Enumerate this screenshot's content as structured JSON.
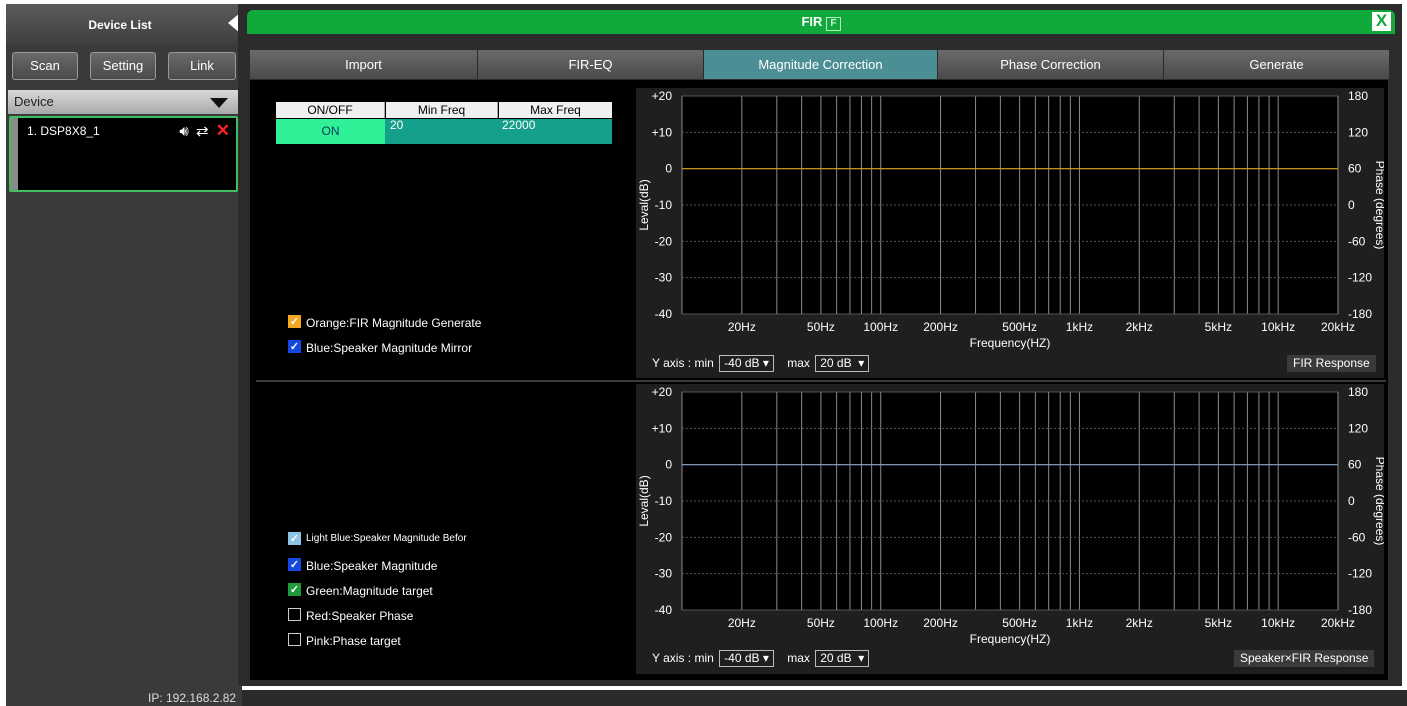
{
  "sidebar": {
    "title": "Device List",
    "buttons": {
      "scan": "Scan",
      "setting": "Setting",
      "link": "Link"
    },
    "device_header": "Device",
    "devices": [
      {
        "name": "1. DSP8X8_1"
      }
    ]
  },
  "status": {
    "ip": "IP: 192.168.2.82"
  },
  "window": {
    "title": "FIR",
    "badge": "F",
    "close": "X"
  },
  "tabs": [
    "Import",
    "FIR-EQ",
    "Magnitude Correction",
    "Phase Correction",
    "Generate"
  ],
  "active_tab": "Magnitude Correction",
  "freq_table": {
    "headers": [
      "ON/OFF",
      "Min Freq",
      "Max Freq"
    ],
    "row": {
      "onoff": "ON",
      "min": "20",
      "max": "22000"
    }
  },
  "top_legend": [
    {
      "label": "Orange:FIR Magnitude Generate",
      "checked": true,
      "color": "#f5a623"
    },
    {
      "label": "Blue:Speaker Magnitude Mirror",
      "checked": true,
      "color": "#1448e0"
    }
  ],
  "bottom_legend": [
    {
      "label": "Light Blue:Speaker Magnitude Befor",
      "checked": true,
      "color": "#8ec3e8"
    },
    {
      "label": "Blue:Speaker Magnitude",
      "checked": true,
      "color": "#1448e0"
    },
    {
      "label": "Green:Magnitude target",
      "checked": true,
      "color": "#1f9a3a"
    },
    {
      "label": "Red:Speaker Phase",
      "checked": false
    },
    {
      "label": "Pink:Phase target",
      "checked": false
    }
  ],
  "charts": {
    "y_ticks": [
      "+20",
      "+10",
      "0",
      "-10",
      "-20",
      "-30",
      "-40"
    ],
    "phase_ticks": [
      "180",
      "120",
      "60",
      "0",
      "-60",
      "-120",
      "-180"
    ],
    "x_ticks": [
      "20Hz",
      "50Hz",
      "100Hz",
      "200Hz",
      "500Hz",
      "1kHz",
      "2kHz",
      "5kHz",
      "10kHz",
      "20kHz"
    ],
    "ylabel": "Leval(dB)",
    "xlabel": "Frequency(HZ)",
    "phase_label": "Phase (degrees)",
    "yaxis": {
      "min_label": "Y axis : min",
      "min_value": "-40 dB",
      "max_label": "max",
      "max_value": "20 dB"
    },
    "top_button": "FIR Response",
    "bottom_button": "Speaker×FIR Response"
  },
  "chart_data": [
    {
      "type": "line",
      "title": "FIR Response",
      "xlabel": "Frequency(HZ)",
      "ylabel": "Leval(dB)",
      "xscale": "log",
      "xlim": [
        10,
        20000
      ],
      "ylim": [
        -40,
        20
      ],
      "y2label": "Phase (degrees)",
      "y2lim": [
        -180,
        180
      ],
      "grid": true,
      "series": [
        {
          "color": "#d9a21b",
          "x": [
            10,
            20000
          ],
          "y": [
            0,
            0
          ]
        }
      ]
    },
    {
      "type": "line",
      "title": "Speaker×FIR Response",
      "xlabel": "Frequency(HZ)",
      "ylabel": "Leval(dB)",
      "xscale": "log",
      "xlim": [
        10,
        20000
      ],
      "ylim": [
        -40,
        20
      ],
      "y2label": "Phase (degrees)",
      "y2lim": [
        -180,
        180
      ],
      "grid": true,
      "series": [
        {
          "color": "#8aa4c8",
          "x": [
            10,
            20000
          ],
          "y": [
            0,
            0
          ]
        }
      ]
    }
  ]
}
